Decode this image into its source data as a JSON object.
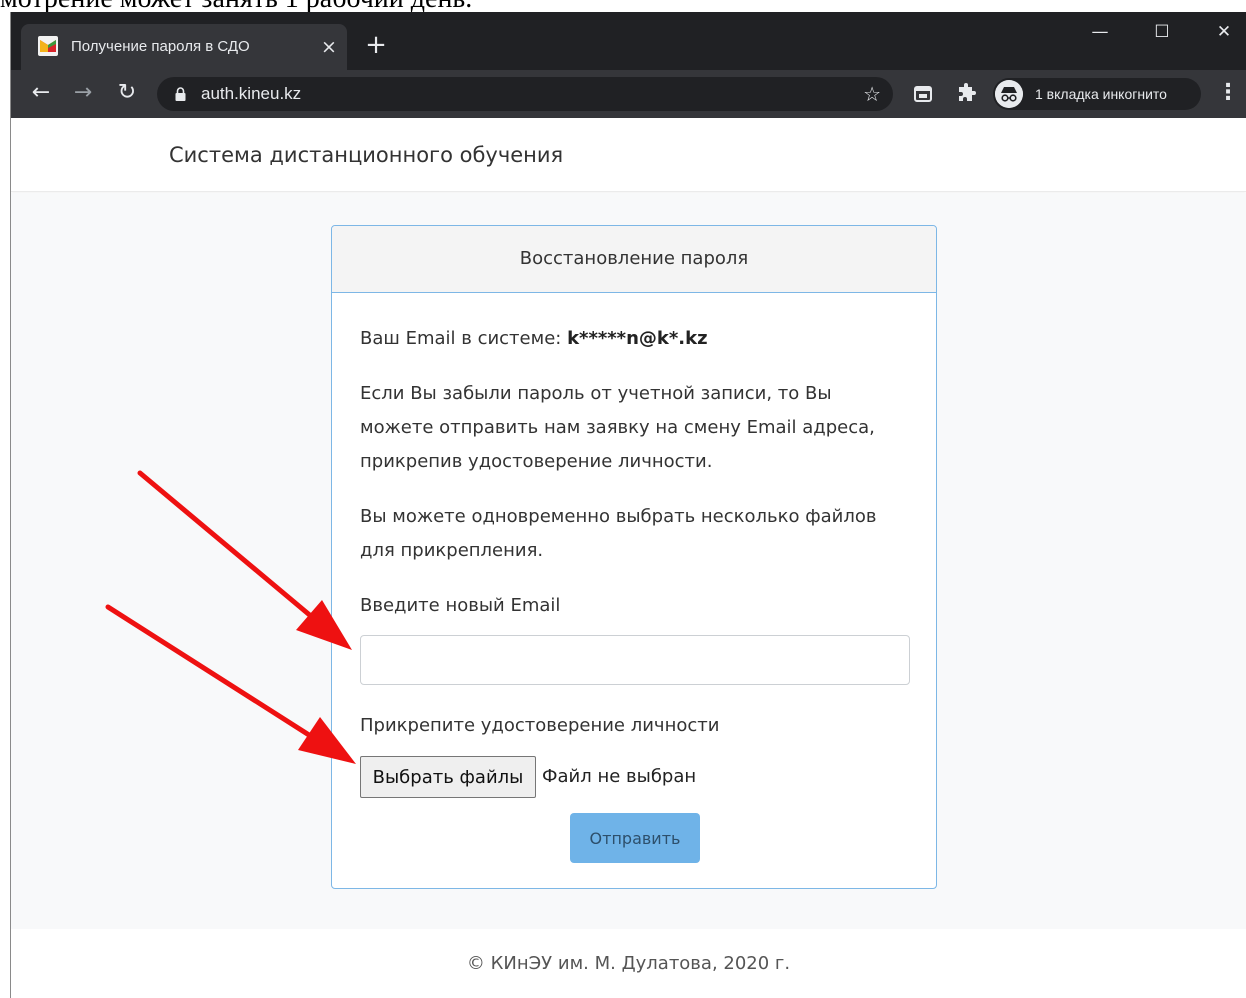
{
  "doc_top_text": "мотрение может занять 1 рабочий день.",
  "browser": {
    "tab_title": "Получение пароля в СДО",
    "tab_close": "×",
    "new_tab": "+",
    "minimize": "—",
    "maximize": "☐",
    "close": "✕",
    "url": "auth.kineu.kz",
    "incognito_label": "1 вкладка инкогнито"
  },
  "site": {
    "brand": "Система дистанционного обучения",
    "card_title": "Восстановление пароля",
    "email_prefix": "Ваш Email в системе: ",
    "email_masked": "k*****n@k*.kz",
    "para_1_line_1": "Если Вы забыли пароль от учетной записи, то Вы",
    "para_1_line_2": "можете отправить нам заявку на смену Email адреса,",
    "para_1_line_3": "прикрепив удостоверение личности.",
    "para_2_line_1": "Вы можете одновременно выбрать несколько файлов",
    "para_2_line_2": "для прикрепления.",
    "new_email_label": "Введите новый Email",
    "new_email_value": "",
    "attach_label": "Прикрепите удостоверение личности",
    "file_button": "Выбрать файлы",
    "file_status": "Файл не выбран",
    "submit": "Отправить",
    "footer": "© КИнЭУ им. М. Дулатова, 2020 г."
  },
  "colors": {
    "chrome_dark": "#202124",
    "chrome_toolbar": "#35363a",
    "card_border": "#7db7e6",
    "submit_bg": "#6fb3e8",
    "annotation_arrow": "#ee1111"
  }
}
